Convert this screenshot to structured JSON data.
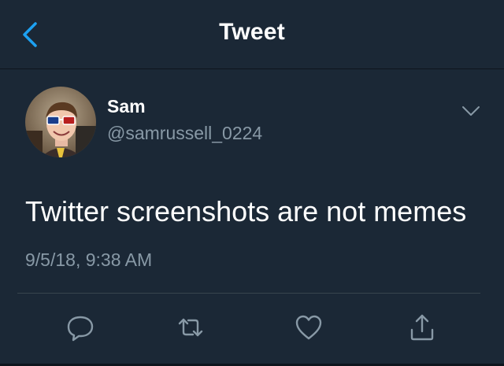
{
  "header": {
    "title": "Tweet",
    "back_icon": "chevron-left-icon"
  },
  "tweet": {
    "author_name": "Sam",
    "author_handle": "@samrussell_0224",
    "text": "Twitter screenshots are not memes",
    "timestamp": "9/5/18, 9:38 AM"
  },
  "actions": [
    {
      "icon": "reply-icon"
    },
    {
      "icon": "retweet-icon"
    },
    {
      "icon": "like-icon"
    },
    {
      "icon": "share-icon"
    }
  ],
  "colors": {
    "background": "#1b2836",
    "accent": "#1da1f2",
    "secondary_text": "#8899a6",
    "primary_text": "#ffffff",
    "divider": "#38444d"
  }
}
